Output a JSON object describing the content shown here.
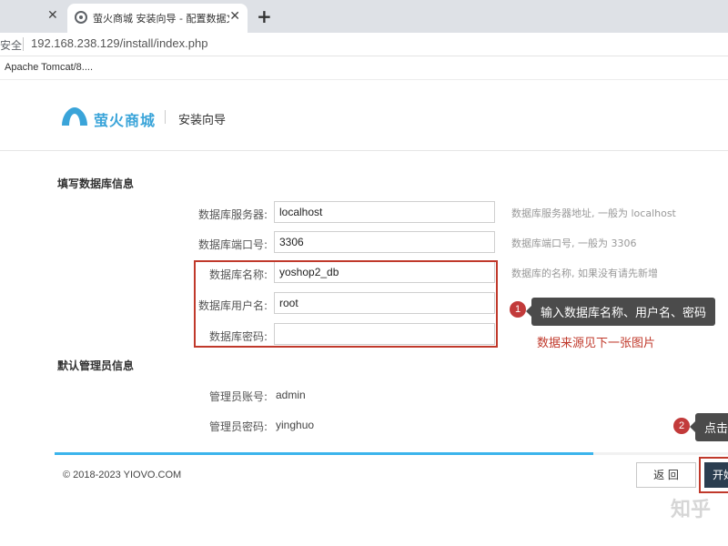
{
  "browser": {
    "tab_title": "萤火商城 安装向导 - 配置数据文",
    "close_glyph": "✕",
    "new_tab_glyph": "+",
    "security_label": "安全",
    "url": "192.168.238.129/install/index.php",
    "bookmark": "Apache Tomcat/8...."
  },
  "header": {
    "brand": "萤火商城",
    "subtitle": "安装向导",
    "brand_color": "#3aa4d9"
  },
  "db_section": {
    "title": "填写数据库信息",
    "fields": [
      {
        "label": "数据库服务器:",
        "value": "localhost",
        "hint": "数据库服务器地址, 一般为 localhost"
      },
      {
        "label": "数据库端口号:",
        "value": "3306",
        "hint": "数据库端口号, 一般为 3306"
      },
      {
        "label": "数据库名称:",
        "value": "yoshop2_db",
        "hint": "数据库的名称, 如果没有请先新增"
      },
      {
        "label": "数据库用户名:",
        "value": "root",
        "hint": ""
      },
      {
        "label": "数据库密码:",
        "value": "",
        "hint": ""
      }
    ]
  },
  "admin_section": {
    "title": "默认管理员信息",
    "fields": [
      {
        "label": "管理员账号:",
        "value": "admin"
      },
      {
        "label": "管理员密码:",
        "value": "yinghuo"
      }
    ]
  },
  "annotations": {
    "marker1": "1",
    "callout1": "输入数据库名称、用户名、密码",
    "note1": "数据来源见下一张图片",
    "marker2": "2",
    "callout2": "点击开",
    "accent_color": "#c0392b"
  },
  "progress": {
    "fraction": 0.8
  },
  "footer": {
    "copyright": "© 2018-2023 YIOVO.COM",
    "back_label": "返 回",
    "start_label": "开始"
  },
  "watermark": "知乎"
}
